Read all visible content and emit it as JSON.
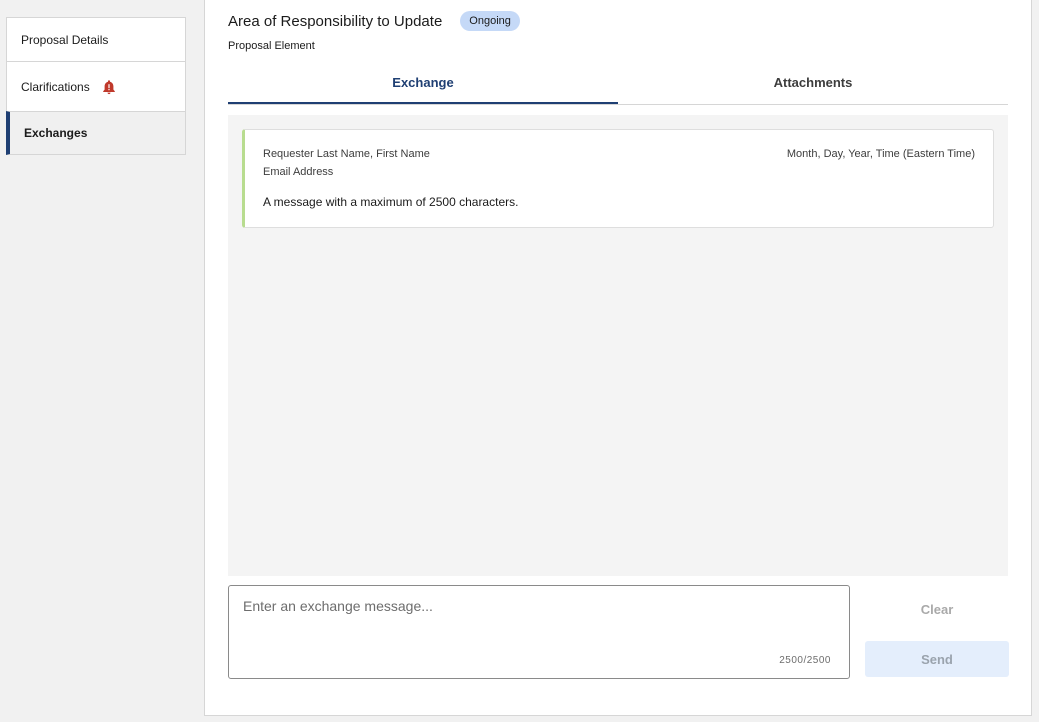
{
  "sidebar": {
    "items": [
      {
        "label": "Proposal Details"
      },
      {
        "label": "Clarifications",
        "icon": "alert-bell-icon"
      },
      {
        "label": "Exchanges",
        "active": true
      }
    ]
  },
  "header": {
    "title": "Area of Responsibility to Update",
    "status_badge": "Ongoing",
    "subtitle": "Proposal Element"
  },
  "tabs": [
    {
      "label": "Exchange",
      "active": true
    },
    {
      "label": "Attachments"
    }
  ],
  "messages": [
    {
      "sender": "Requester Last Name, First Name",
      "email": "Email Address",
      "timestamp": "Month, Day, Year, Time (Eastern Time)",
      "body": "A message with a maximum of 2500 characters."
    }
  ],
  "composer": {
    "placeholder": "Enter an exchange message...",
    "value": "",
    "char_count": "2500/2500"
  },
  "actions": {
    "clear_label": "Clear",
    "send_label": "Send"
  },
  "colors": {
    "accent": "#1f3f73",
    "badge": "#c5d9f7",
    "alert": "#c0392b",
    "message_border": "#b8dc8f"
  }
}
